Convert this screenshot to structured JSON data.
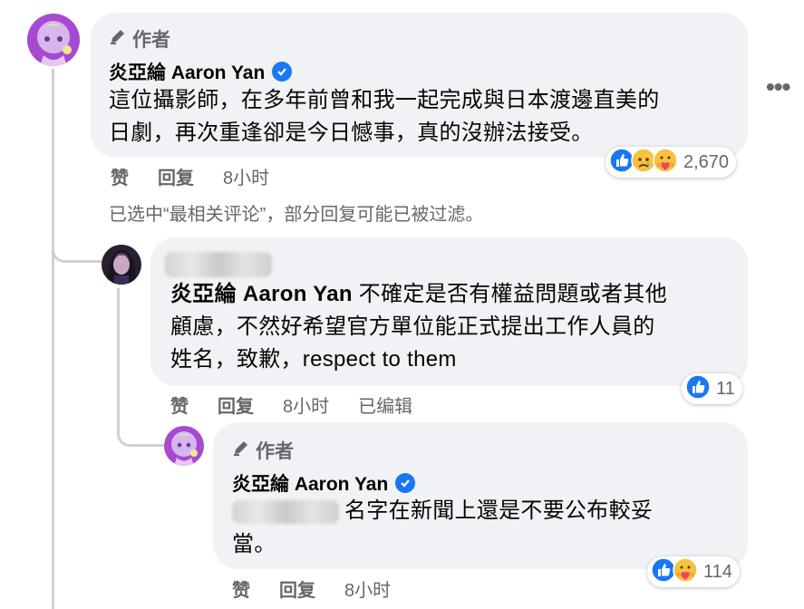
{
  "comment1": {
    "author_label": "作者",
    "name": "炎亞綸 Aaron Yan",
    "text_line1": "這位攝影師，在多年前曾和我一起完成與日本渡邊直美的",
    "text_line2": "日劇，再次重逢卻是今日憾事，真的沒辦法接受。",
    "like_label": "赞",
    "reply_label": "回复",
    "time": "8小时",
    "reaction_count": "2,670"
  },
  "filter_note": "已选中“最相关评论”，部分回复可能已被过滤。",
  "reply1": {
    "mention": "炎亞綸 Aaron Yan",
    "text_line1_rest": " 不確定是否有權益問題或者其他",
    "text_line2": "顧慮，不然好希望官方單位能正式提出工作人員的",
    "text_line3": "姓名，致歉，respect to them",
    "like_label": "赞",
    "reply_label": "回复",
    "time": "8小时",
    "edited_label": "已编辑",
    "reaction_count": "11"
  },
  "reply2": {
    "author_label": "作者",
    "name": "炎亞綸 Aaron Yan",
    "text_line1_rest": "名字在新聞上還是不要公布較妥",
    "text_line2": "當。",
    "like_label": "赞",
    "reply_label": "回复",
    "time": "8小时",
    "reaction_count": "114"
  },
  "colors": {
    "accent": "#1877f2",
    "bubble": "#f0f2f5",
    "muted": "#65676b"
  }
}
